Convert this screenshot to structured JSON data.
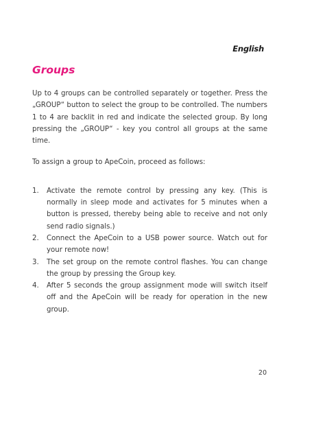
{
  "header": {
    "language": "English"
  },
  "section": {
    "title": "Groups",
    "intro": "Up to 4 groups can be controlled separately or together. Press the „GROUP“ button to select the group to be controlled. The numbers 1 to 4 are backlit in red and indicate the selected group. By long pressing the „GROUP“ - key you control all groups at the same time.",
    "assign_intro": "To assign a group to ApeCoin, proceed as follows:",
    "steps": [
      {
        "number": "1.",
        "text": "Activate the remote control by pressing any key. (This is normally in sleep mode and activates for 5 minutes when a button is pressed, thereby being able to receive and not only send radio signals.)"
      },
      {
        "number": "2.",
        "text": "Connect the ApeCoin to a USB power source. Watch out for your remote now!"
      },
      {
        "number": "3.",
        "text": "The set group on the remote control flashes. You can change the group by pressing the Group key."
      },
      {
        "number": "4.",
        "text": "After 5 seconds the group assignment mode will switch itself off and the ApeCoin will be ready for operation in the new group."
      }
    ]
  },
  "footer": {
    "page_number": "20"
  },
  "colors": {
    "title": "#e6197e",
    "body_text": "#3a3a3a"
  }
}
